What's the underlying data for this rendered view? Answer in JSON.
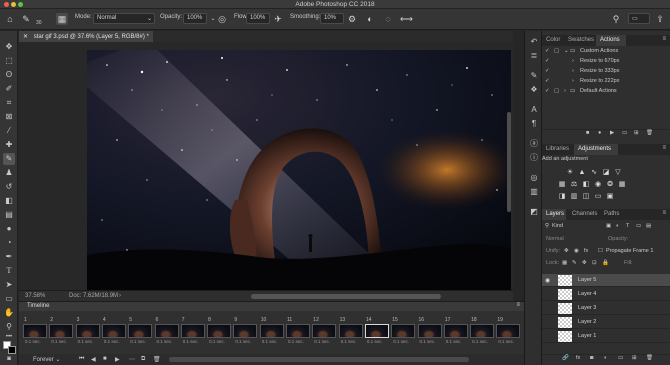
{
  "app": {
    "title": "Adobe Photoshop CC 2018"
  },
  "options_bar": {
    "brush_size": "30",
    "mode_label": "Mode:",
    "mode_value": "Normal",
    "opacity_label": "Opacity:",
    "opacity_value": "100%",
    "flow_label": "Flow:",
    "flow_value": "100%",
    "smoothing_label": "Smoothing:",
    "smoothing_value": "10%"
  },
  "document": {
    "tab_title": "star gif 3.psd @ 37.6% (Layer 5, RGB/8#) *",
    "zoom": "37.58%",
    "doc_info": "Doc: 7.62M/18.9M"
  },
  "timeline": {
    "title": "Timeline",
    "loop_value": "Forever",
    "frames": [
      {
        "num": "1",
        "dur": "0.1 sec."
      },
      {
        "num": "2",
        "dur": "0.1 sec."
      },
      {
        "num": "3",
        "dur": "0.1 sec."
      },
      {
        "num": "4",
        "dur": "0.1 sec."
      },
      {
        "num": "5",
        "dur": "0.1 sec."
      },
      {
        "num": "6",
        "dur": "0.1 sec."
      },
      {
        "num": "7",
        "dur": "0.1 sec."
      },
      {
        "num": "8",
        "dur": "0.1 sec."
      },
      {
        "num": "9",
        "dur": "0.1 sec."
      },
      {
        "num": "10",
        "dur": "0.1 sec."
      },
      {
        "num": "11",
        "dur": "0.1 sec."
      },
      {
        "num": "12",
        "dur": "0.1 sec."
      },
      {
        "num": "13",
        "dur": "0.1 sec."
      },
      {
        "num": "14",
        "dur": "0.1 sec."
      },
      {
        "num": "15",
        "dur": "0.1 sec."
      },
      {
        "num": "16",
        "dur": "0.1 sec."
      },
      {
        "num": "17",
        "dur": "0.1 sec."
      },
      {
        "num": "18",
        "dur": "0.1 sec."
      },
      {
        "num": "19",
        "dur": "0.1 sec."
      }
    ],
    "selected_frame": "14"
  },
  "actions_panel": {
    "tabs": [
      "Color",
      "Swatches",
      "Actions"
    ],
    "items": [
      {
        "label": "Custom Actions"
      },
      {
        "label": "Resize to 670px"
      },
      {
        "label": "Resize to 333px"
      },
      {
        "label": "Resize to 222px"
      },
      {
        "label": "Default Actions"
      }
    ]
  },
  "adjustments_panel": {
    "tabs": [
      "Libraries",
      "Adjustments"
    ],
    "heading": "Add an adjustment"
  },
  "layers_panel": {
    "tabs": [
      "Layers",
      "Channels",
      "Paths"
    ],
    "kind_filter": "Kind",
    "blend_mode": "Normal",
    "opacity_label": "Opacity:",
    "unify_label": "Unify:",
    "propagate_label": "Propagate Frame 1",
    "lock_label": "Lock:",
    "fill_label": "Fill:",
    "layers": [
      {
        "name": "Layer 5"
      },
      {
        "name": "Layer 4"
      },
      {
        "name": "Layer 3"
      },
      {
        "name": "Layer 2"
      },
      {
        "name": "Layer 1"
      }
    ]
  },
  "colors": {
    "accent": "#4a90d9",
    "panel_bg": "#2f2f2f",
    "chrome_bg": "#353535"
  }
}
